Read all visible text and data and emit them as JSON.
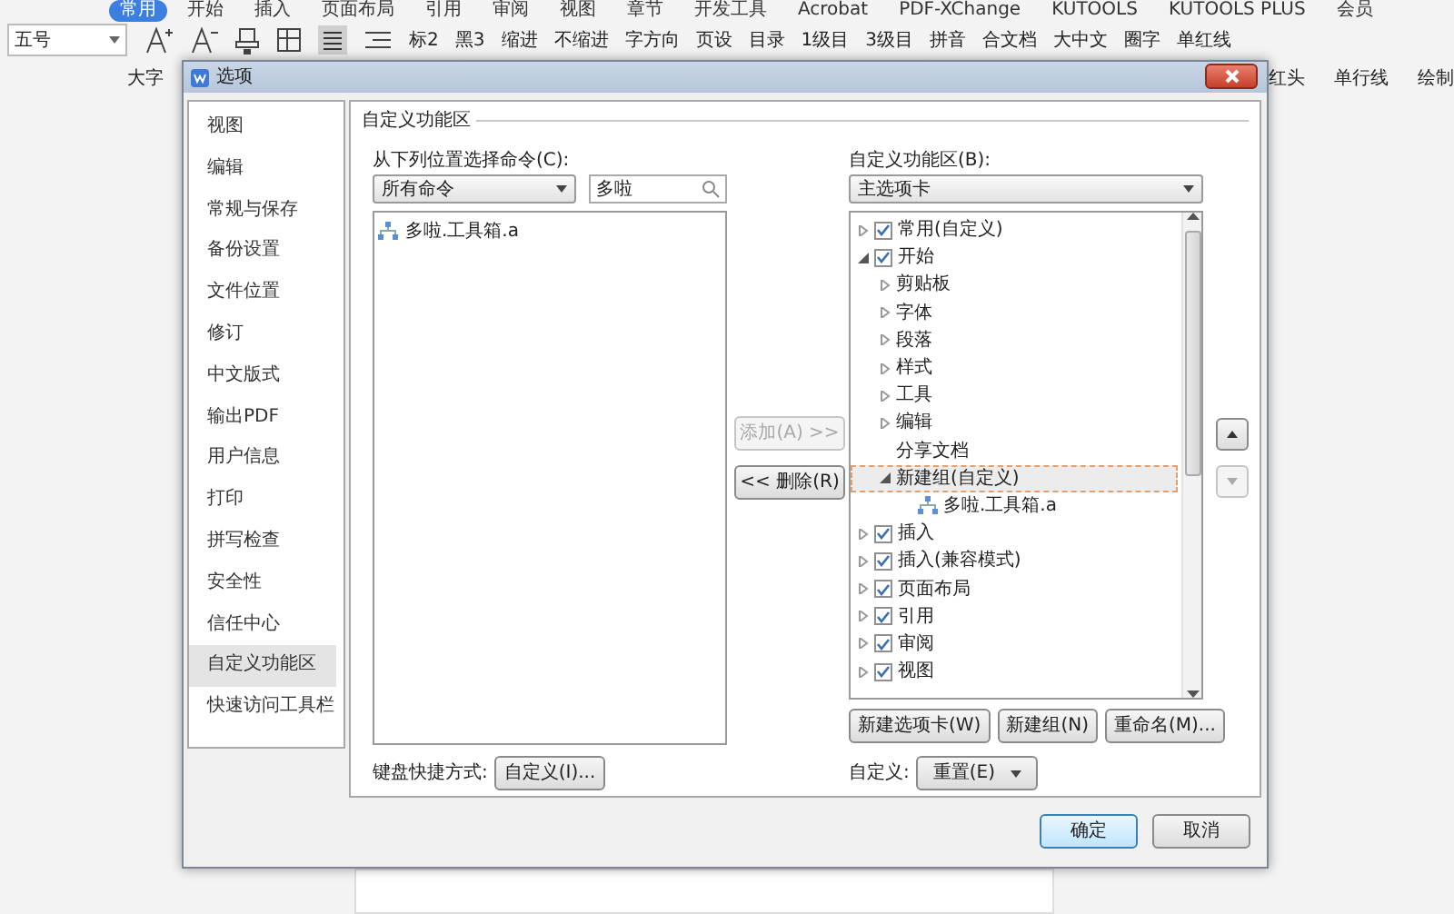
{
  "ribbon": {
    "tabs": [
      {
        "label": "常用",
        "selected": true
      },
      {
        "label": "开始",
        "selected": false
      },
      {
        "label": "插入",
        "selected": false
      },
      {
        "label": "页面布局",
        "selected": false
      },
      {
        "label": "引用",
        "selected": false
      },
      {
        "label": "审阅",
        "selected": false
      },
      {
        "label": "视图",
        "selected": false
      },
      {
        "label": "章节",
        "selected": false
      },
      {
        "label": "开发工具",
        "selected": false
      },
      {
        "label": "Acrobat",
        "selected": false
      },
      {
        "label": "PDF-XChange",
        "selected": false
      },
      {
        "label": "KUTOOLS",
        "selected": false
      },
      {
        "label": "KUTOOLS PLUS",
        "selected": false
      },
      {
        "label": "会员",
        "selected": false
      }
    ],
    "font_size": "五号",
    "tools": [
      "标2",
      "黑3",
      "缩进",
      "不缩进",
      "字方向",
      "页设",
      "目录",
      "1级目",
      "3级目",
      "拼音",
      "合文档",
      "大中文",
      "圈字",
      "单红线"
    ],
    "second_row_left": [
      "大字"
    ],
    "second_row_right": [
      "红头",
      "单行线",
      "绘制"
    ]
  },
  "dialog": {
    "title": "选项",
    "sidebar": [
      {
        "label": "视图",
        "selected": false
      },
      {
        "label": "编辑",
        "selected": false
      },
      {
        "label": "常规与保存",
        "selected": false
      },
      {
        "label": "备份设置",
        "selected": false
      },
      {
        "label": "文件位置",
        "selected": false
      },
      {
        "label": "修订",
        "selected": false
      },
      {
        "label": "中文版式",
        "selected": false
      },
      {
        "label": "输出PDF",
        "selected": false
      },
      {
        "label": "用户信息",
        "selected": false
      },
      {
        "label": "打印",
        "selected": false
      },
      {
        "label": "拼写检查",
        "selected": false
      },
      {
        "label": "安全性",
        "selected": false
      },
      {
        "label": "信任中心",
        "selected": false
      },
      {
        "label": "自定义功能区",
        "selected": true
      },
      {
        "label": "快速访问工具栏",
        "selected": false
      }
    ],
    "section_title": "自定义功能区",
    "commands": {
      "label": "从下列位置选择命令(C):",
      "source": "所有命令",
      "search": "多啦",
      "items": [
        {
          "label": "多啦.工具箱.a",
          "selected": false
        }
      ]
    },
    "add_button": {
      "label": "添加(A) >>",
      "disabled": true
    },
    "remove_button": {
      "label": "<< 删除(R)",
      "disabled": false
    },
    "keyboard_label": "键盘快捷方式:",
    "keyboard_button": "自定义(I)...",
    "ribbon_tree": {
      "label": "自定义功能区(B):",
      "source": "主选项卡",
      "nodes": [
        {
          "kind": "tab",
          "label": "常用(自定义)",
          "checked": true,
          "expanded": false,
          "selected": false
        },
        {
          "kind": "tab",
          "label": "开始",
          "checked": true,
          "expanded": true,
          "selected": false,
          "children": [
            {
              "kind": "group",
              "label": "剪贴板",
              "expanded": false,
              "selected": false
            },
            {
              "kind": "group",
              "label": "字体",
              "expanded": false,
              "selected": false
            },
            {
              "kind": "group",
              "label": "段落",
              "expanded": false,
              "selected": false
            },
            {
              "kind": "group",
              "label": "样式",
              "expanded": false,
              "selected": false
            },
            {
              "kind": "group",
              "label": "工具",
              "expanded": false,
              "selected": false
            },
            {
              "kind": "group",
              "label": "编辑",
              "expanded": false,
              "selected": false
            },
            {
              "kind": "item",
              "label": "分享文档",
              "selected": false
            },
            {
              "kind": "group",
              "label": "新建组(自定义)",
              "expanded": true,
              "selected": true,
              "children": [
                {
                  "kind": "command",
                  "label": "多啦.工具箱.a",
                  "selected": false
                }
              ]
            }
          ]
        },
        {
          "kind": "tab",
          "label": "插入",
          "checked": true,
          "expanded": false,
          "selected": false
        },
        {
          "kind": "tab",
          "label": "插入(兼容模式)",
          "checked": true,
          "expanded": false,
          "selected": false
        },
        {
          "kind": "tab",
          "label": "页面布局",
          "checked": true,
          "expanded": false,
          "selected": false
        },
        {
          "kind": "tab",
          "label": "引用",
          "checked": true,
          "expanded": false,
          "selected": false
        },
        {
          "kind": "tab",
          "label": "审阅",
          "checked": true,
          "expanded": false,
          "selected": false
        },
        {
          "kind": "tab",
          "label": "视图",
          "checked": true,
          "expanded": false,
          "selected": false
        }
      ]
    },
    "move_up": {
      "disabled": false
    },
    "move_down": {
      "disabled": true
    },
    "tree_buttons": [
      "新建选项卡(W)",
      "新建组(N)",
      "重命名(M)..."
    ],
    "customize_label": "自定义:",
    "reset_button": "重置(E)",
    "ok_button": "确定",
    "cancel_button": "取消"
  }
}
